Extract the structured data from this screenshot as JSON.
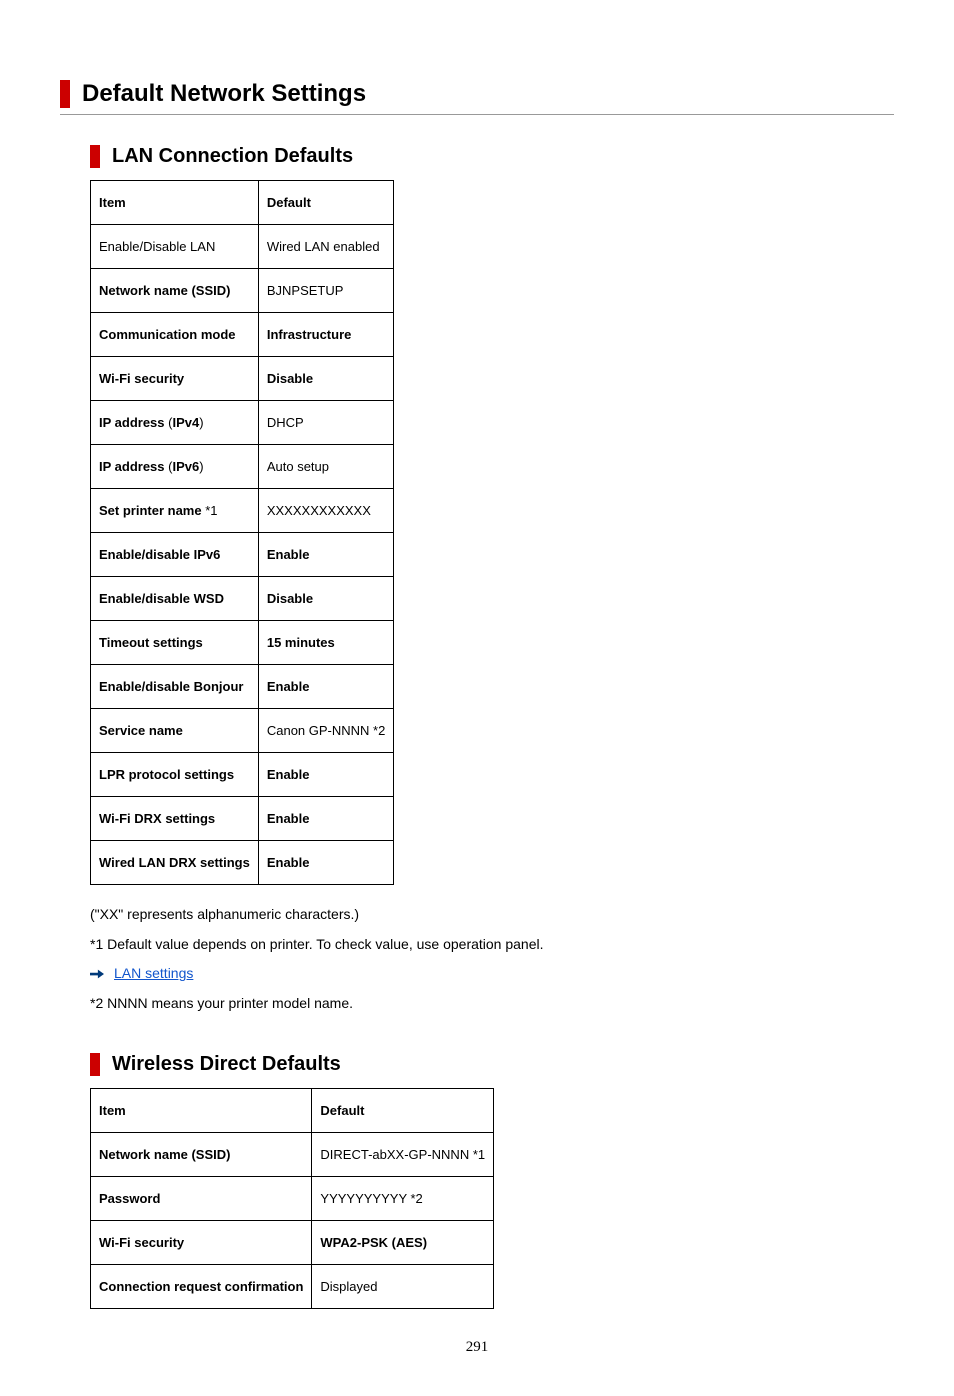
{
  "page_title": "Default Network Settings",
  "section1": {
    "heading": "LAN Connection Defaults",
    "headers": {
      "item": "Item",
      "default": "Default"
    },
    "rows": [
      {
        "item": "Enable/Disable LAN",
        "item_bold": false,
        "default": "Wired LAN enabled",
        "default_bold": false
      },
      {
        "item": "Network name (SSID)",
        "item_bold": true,
        "default": "BJNPSETUP",
        "default_bold": false
      },
      {
        "item": "Communication mode",
        "item_bold": true,
        "default": "Infrastructure",
        "default_bold": true
      },
      {
        "item": "Wi-Fi security",
        "item_bold": true,
        "default": "Disable",
        "default_bold": true
      },
      {
        "item_html": "<span class='bold'>IP address</span> (<span class='bold'>IPv4</span>)",
        "default": "DHCP",
        "default_bold": false
      },
      {
        "item_html": "<span class='bold'>IP address</span> (<span class='bold'>IPv6</span>)",
        "default": "Auto setup",
        "default_bold": false
      },
      {
        "item_html": "<span class='bold'>Set printer name</span> *1",
        "default": "XXXXXXXXXXXX",
        "default_bold": false
      },
      {
        "item": "Enable/disable IPv6",
        "item_bold": true,
        "default": "Enable",
        "default_bold": true
      },
      {
        "item": "Enable/disable WSD",
        "item_bold": true,
        "default": "Disable",
        "default_bold": true
      },
      {
        "item": "Timeout settings",
        "item_bold": true,
        "default": "15 minutes",
        "default_bold": true
      },
      {
        "item": "Enable/disable Bonjour",
        "item_bold": true,
        "default": "Enable",
        "default_bold": true
      },
      {
        "item": "Service name",
        "item_bold": true,
        "default": "Canon GP-NNNN *2",
        "default_bold": false
      },
      {
        "item": "LPR protocol settings",
        "item_bold": true,
        "default": "Enable",
        "default_bold": true
      },
      {
        "item": "Wi-Fi DRX settings",
        "item_bold": true,
        "default": "Enable",
        "default_bold": true
      },
      {
        "item": "Wired LAN DRX settings",
        "item_bold": true,
        "default": "Enable",
        "default_bold": true
      }
    ]
  },
  "notes": {
    "n1": "(\"XX\" represents alphanumeric characters.)",
    "n2": "*1 Default value depends on printer. To check value, use operation panel.",
    "link_text": "LAN settings",
    "n3": "*2 NNNN means your printer model name."
  },
  "section2": {
    "heading": "Wireless Direct Defaults",
    "headers": {
      "item": "Item",
      "default": "Default"
    },
    "rows": [
      {
        "item": "Network name (SSID)",
        "item_bold": true,
        "default": "DIRECT-abXX-GP-NNNN *1",
        "default_bold": false
      },
      {
        "item": "Password",
        "item_bold": true,
        "default": "YYYYYYYYYY *2",
        "default_bold": false
      },
      {
        "item": "Wi-Fi security",
        "item_bold": true,
        "default": "WPA2-PSK (AES)",
        "default_bold": true
      },
      {
        "item": "Connection request confirmation",
        "item_bold": true,
        "default": "Displayed",
        "default_bold": false
      }
    ]
  },
  "page_number": "291"
}
